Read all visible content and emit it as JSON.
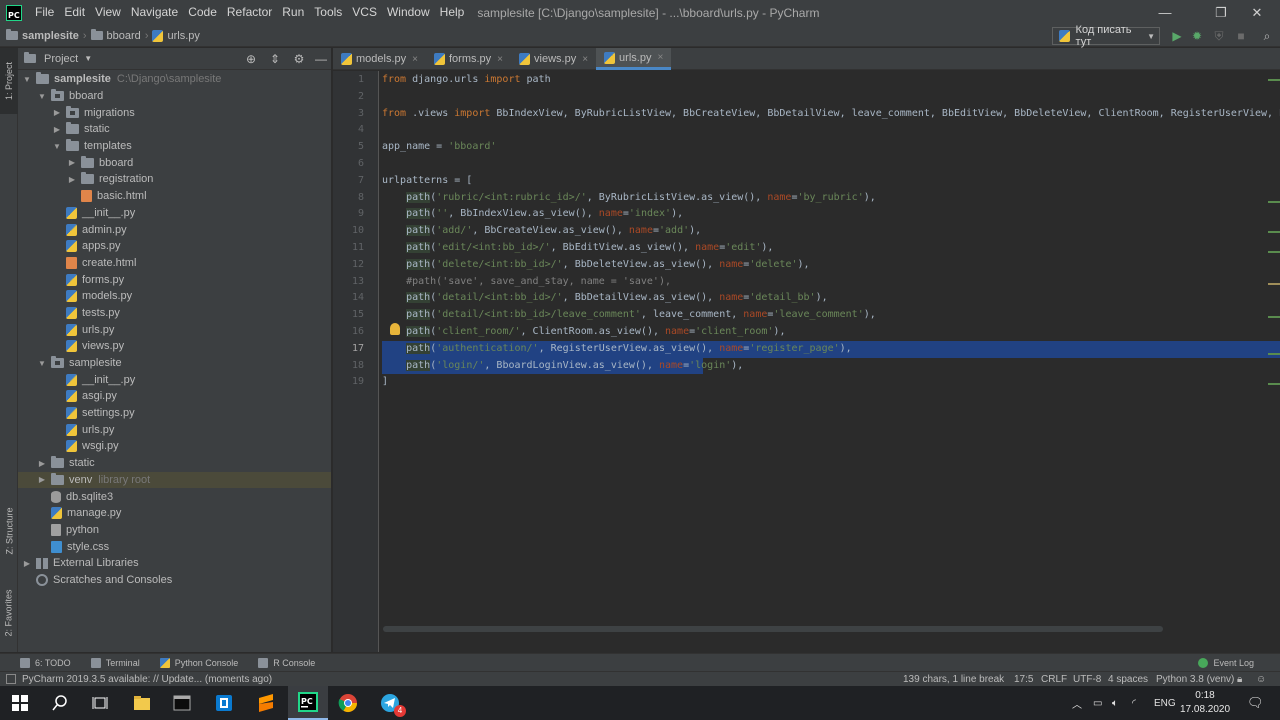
{
  "window": {
    "title": "samplesite [C:\\Django\\samplesite] - ...\\bboard\\urls.py - PyCharm",
    "menu": [
      "File",
      "Edit",
      "View",
      "Navigate",
      "Code",
      "Refactor",
      "Run",
      "Tools",
      "VCS",
      "Window",
      "Help"
    ],
    "controls": {
      "minimize": "—",
      "maximize": "❐",
      "close": "✕"
    }
  },
  "navbar": {
    "breadcrumbs": [
      "samplesite",
      "bboard",
      "urls.py"
    ],
    "run_config": "Код писать тут",
    "icons": [
      "run-icon",
      "debug-icon",
      "coverage-icon",
      "stop-icon",
      "search-everywhere-icon"
    ]
  },
  "left_strip": {
    "project": "1: Project",
    "structure": "Z: Structure",
    "favorites": "2: Favorites"
  },
  "project_panel": {
    "title": "Project",
    "tree": [
      {
        "label": "samplesite",
        "hint": "C:\\Django\\samplesite",
        "depth": 0,
        "expanded": true,
        "type": "folder",
        "bold": true
      },
      {
        "label": "bboard",
        "depth": 1,
        "expanded": true,
        "type": "pkg"
      },
      {
        "label": "migrations",
        "depth": 2,
        "expanded": false,
        "type": "pkg"
      },
      {
        "label": "static",
        "depth": 2,
        "expanded": false,
        "type": "folder"
      },
      {
        "label": "templates",
        "depth": 2,
        "expanded": true,
        "type": "folder"
      },
      {
        "label": "bboard",
        "depth": 3,
        "expanded": false,
        "type": "folder"
      },
      {
        "label": "registration",
        "depth": 3,
        "expanded": false,
        "type": "folder"
      },
      {
        "label": "basic.html",
        "depth": 3,
        "type": "html"
      },
      {
        "label": "__init__.py",
        "depth": 2,
        "type": "py"
      },
      {
        "label": "admin.py",
        "depth": 2,
        "type": "py"
      },
      {
        "label": "apps.py",
        "depth": 2,
        "type": "py"
      },
      {
        "label": "create.html",
        "depth": 2,
        "type": "html"
      },
      {
        "label": "forms.py",
        "depth": 2,
        "type": "py"
      },
      {
        "label": "models.py",
        "depth": 2,
        "type": "py"
      },
      {
        "label": "tests.py",
        "depth": 2,
        "type": "py"
      },
      {
        "label": "urls.py",
        "depth": 2,
        "type": "py"
      },
      {
        "label": "views.py",
        "depth": 2,
        "type": "py"
      },
      {
        "label": "samplesite",
        "depth": 1,
        "expanded": true,
        "type": "pkg"
      },
      {
        "label": "__init__.py",
        "depth": 2,
        "type": "py"
      },
      {
        "label": "asgi.py",
        "depth": 2,
        "type": "py"
      },
      {
        "label": "settings.py",
        "depth": 2,
        "type": "py"
      },
      {
        "label": "urls.py",
        "depth": 2,
        "type": "py"
      },
      {
        "label": "wsgi.py",
        "depth": 2,
        "type": "py"
      },
      {
        "label": "static",
        "depth": 1,
        "expanded": false,
        "type": "folder"
      },
      {
        "label": "venv",
        "hint": "library root",
        "depth": 1,
        "expanded": false,
        "type": "folder",
        "selected": true
      },
      {
        "label": "db.sqlite3",
        "depth": 1,
        "type": "db"
      },
      {
        "label": "manage.py",
        "depth": 1,
        "type": "py"
      },
      {
        "label": "python",
        "depth": 1,
        "type": "file"
      },
      {
        "label": "style.css",
        "depth": 1,
        "type": "css"
      },
      {
        "label": "External Libraries",
        "depth": 0,
        "expanded": false,
        "type": "lib"
      },
      {
        "label": "Scratches and Consoles",
        "depth": 0,
        "type": "scratch"
      }
    ]
  },
  "editor": {
    "tabs": [
      {
        "label": "models.py",
        "active": false
      },
      {
        "label": "forms.py",
        "active": false
      },
      {
        "label": "views.py",
        "active": false
      },
      {
        "label": "urls.py",
        "active": true
      }
    ],
    "current_line": 17,
    "lines": [
      "from django.urls import path",
      "",
      "from .views import BbIndexView, ByRubricListView, BbCreateView, BbDetailView, leave_comment, BbEditView, BbDeleteView, ClientRoom, RegisterUserView, B",
      "",
      "app_name = 'bboard'",
      "",
      "urlpatterns = [",
      "    path('rubric/<int:rubric_id>/', ByRubricListView.as_view(), name='by_rubric'),",
      "    path('', BbIndexView.as_view(), name='index'),",
      "    path('add/', BbCreateView.as_view(), name='add'),",
      "    path('edit/<int:bb_id>/', BbEditView.as_view(), name='edit'),",
      "    path('delete/<int:bb_id>/', BbDeleteView.as_view(), name='delete'),",
      "    #path('save', save_and_stay, name = 'save'),",
      "    path('detail/<int:bb_id>/', BbDetailView.as_view(), name='detail_bb'),",
      "    path('detail/<int:bb_id>/leave_comment', leave_comment, name='leave_comment'),",
      "    path('client_room/', ClientRoom.as_view(), name='client_room'),",
      "    path('authentication/', RegisterUserView.as_view(), name='register_page'),",
      "    path('login/', BboardLoginView.as_view(), name='login'),",
      "]"
    ]
  },
  "bottom_tools": {
    "todo": "6: TODO",
    "terminal": "Terminal",
    "python_console": "Python Console",
    "r_console": "R Console",
    "event_log": "Event Log"
  },
  "statusbar": {
    "message": "PyCharm 2019.3.5 available: // Update... (moments ago)",
    "selection": "139 chars, 1 line break",
    "position": "17:5",
    "line_sep": "CRLF",
    "encoding": "UTF-8",
    "indent": "4 spaces",
    "interpreter": "Python 3.8 (venv)"
  },
  "taskbar": {
    "apps": [
      "windows-start-icon",
      "search-icon",
      "task-view-icon",
      "file-explorer-icon",
      "terminal-icon",
      "app-store-icon",
      "sublime-icon",
      "pycharm-icon",
      "chrome-icon",
      "telegram-icon"
    ],
    "telegram_badge": "4",
    "lang": "ENG",
    "time": "0:18",
    "date": "17.08.2020"
  },
  "colors": {
    "keyword": "#cc7832",
    "string": "#6a8759",
    "param": "#aa4926",
    "selection": "#214283",
    "panel": "#3c3f41",
    "editor_bg": "#2b2b2b"
  }
}
